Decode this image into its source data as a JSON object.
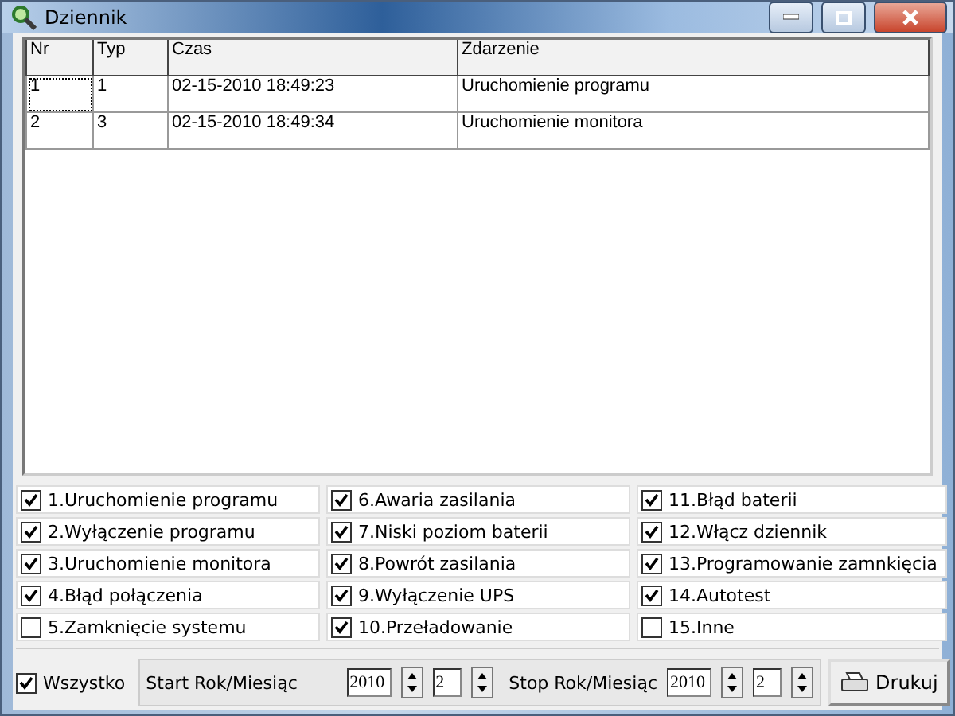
{
  "window": {
    "title": "Dziennik"
  },
  "table": {
    "columns": [
      "Nr",
      "Typ",
      "Czas",
      "Zdarzenie"
    ],
    "rows": [
      {
        "selected": true,
        "cells": [
          "1",
          "1",
          "02-15-2010 18:49:23",
          "Uruchomienie programu"
        ]
      },
      {
        "selected": false,
        "cells": [
          "2",
          "3",
          "02-15-2010 18:49:34",
          "Uruchomienie monitora"
        ]
      }
    ]
  },
  "filters": [
    {
      "label": "1.Uruchomienie programu",
      "checked": true
    },
    {
      "label": "2.Wyłączenie programu",
      "checked": true
    },
    {
      "label": "3.Uruchomienie monitora",
      "checked": true
    },
    {
      "label": "4.Błąd połączenia",
      "checked": true
    },
    {
      "label": "5.Zamknięcie systemu",
      "checked": false
    },
    {
      "label": "6.Awaria zasilania",
      "checked": true
    },
    {
      "label": "7.Niski poziom baterii",
      "checked": true
    },
    {
      "label": "8.Powrót zasilania",
      "checked": true
    },
    {
      "label": "9.Wyłączenie UPS",
      "checked": true
    },
    {
      "label": "10.Przeładowanie",
      "checked": true
    },
    {
      "label": "11.Błąd baterii",
      "checked": true
    },
    {
      "label": "12.Włącz dziennik",
      "checked": true
    },
    {
      "label": "13.Programowanie zamnkięcia",
      "checked": true
    },
    {
      "label": "14.Autotest",
      "checked": true
    },
    {
      "label": "15.Inne",
      "checked": false
    }
  ],
  "all": {
    "label": "Wszystko",
    "checked": true
  },
  "start": {
    "label": "Start Rok/Miesiąc",
    "year": "2010",
    "month": "2"
  },
  "stop": {
    "label": "Stop Rok/Miesiąc",
    "year": "2010",
    "month": "2"
  },
  "print_button": "Drukuj"
}
